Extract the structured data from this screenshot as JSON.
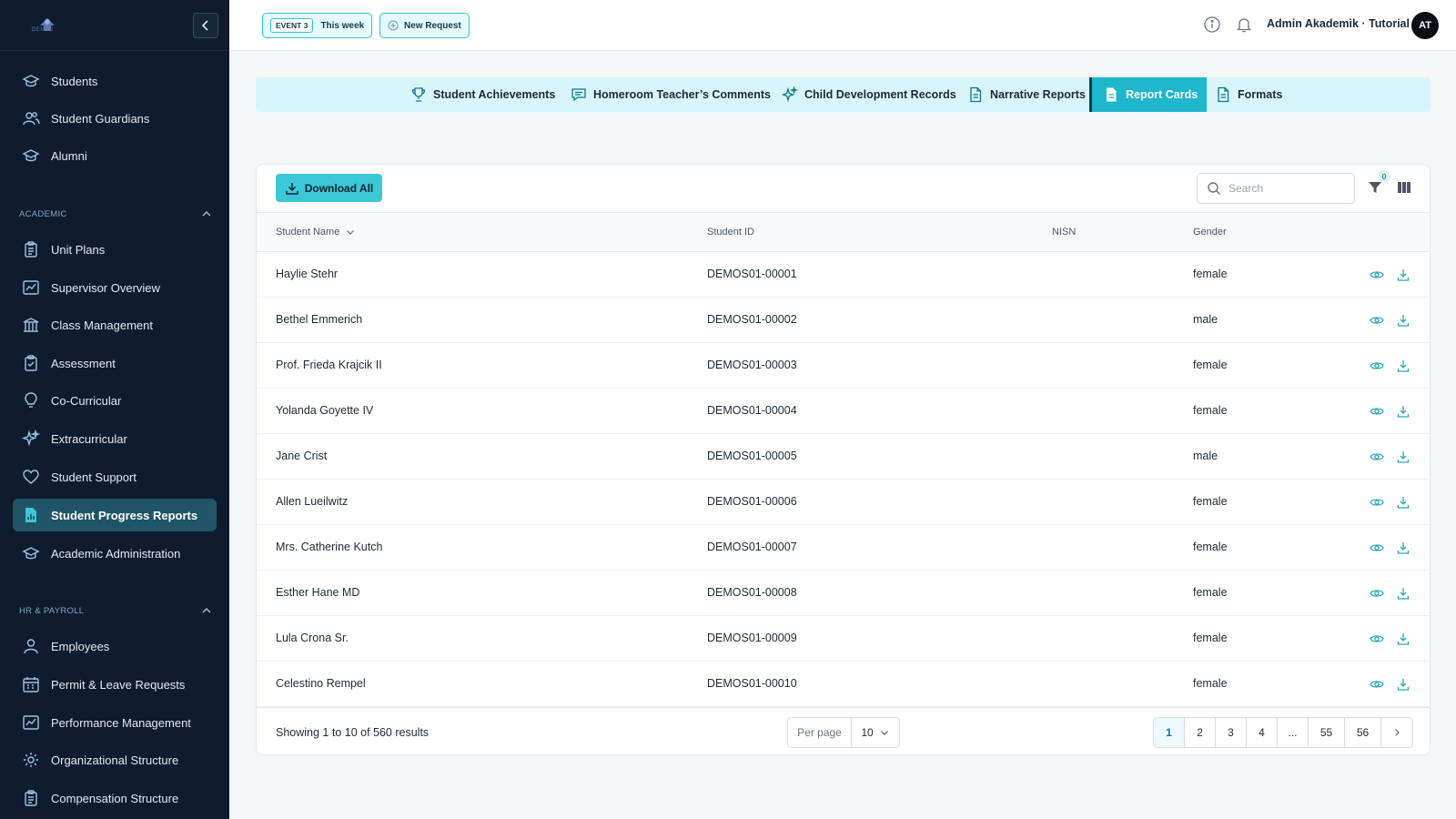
{
  "brand": {
    "logo_text": "DEMAS"
  },
  "sidebar": {
    "top_items": [
      {
        "label": "Students",
        "icon": "graduation-cap-icon"
      },
      {
        "label": "Student Guardians",
        "icon": "users-icon"
      },
      {
        "label": "Alumni",
        "icon": "graduation-cap-icon"
      }
    ],
    "sections": [
      {
        "title": "ACADEMIC",
        "items": [
          {
            "label": "Unit Plans",
            "icon": "clipboard-icon"
          },
          {
            "label": "Supervisor Overview",
            "icon": "chart-icon"
          },
          {
            "label": "Class Management",
            "icon": "building-icon"
          },
          {
            "label": "Assessment",
            "icon": "clipboard-check-icon"
          },
          {
            "label": "Co-Curricular",
            "icon": "lightbulb-icon"
          },
          {
            "label": "Extracurricular",
            "icon": "sparkles-icon"
          },
          {
            "label": "Student Support",
            "icon": "heart-icon"
          },
          {
            "label": "Student Progress Reports",
            "icon": "file-chart-icon",
            "active": true
          },
          {
            "label": "Academic Administration",
            "icon": "graduation-cap-icon"
          }
        ]
      },
      {
        "title": "HR & PAYROLL",
        "items": [
          {
            "label": "Employees",
            "icon": "user-icon"
          },
          {
            "label": "Permit & Leave Requests",
            "icon": "calendar-icon"
          },
          {
            "label": "Performance Management",
            "icon": "chart-icon"
          },
          {
            "label": "Organizational Structure",
            "icon": "gear-icon"
          },
          {
            "label": "Compensation Structure",
            "icon": "clipboard-icon"
          }
        ]
      }
    ]
  },
  "topbar": {
    "event_tag": "EVENT 3",
    "event_label": "This week",
    "new_request": "New Request",
    "user_name": "Admin Akademik · Tutorial",
    "avatar_initials": "AT"
  },
  "tabs": [
    {
      "label": "Student Achievements",
      "icon": "trophy-icon"
    },
    {
      "label": "Homeroom Teacher’s Comments",
      "icon": "chat-icon"
    },
    {
      "label": "Child Development Records",
      "icon": "sparkles-icon"
    },
    {
      "label": "Narrative Reports",
      "icon": "document-icon"
    },
    {
      "label": "Report Cards",
      "icon": "document-icon",
      "active": true
    },
    {
      "label": "Formats",
      "icon": "document-icon"
    }
  ],
  "toolbar": {
    "download_all": "Download All",
    "search_placeholder": "Search",
    "filter_count": "0"
  },
  "table": {
    "columns": [
      "Student Name",
      "Student ID",
      "NISN",
      "Gender"
    ],
    "rows": [
      {
        "name": "Haylie Stehr",
        "id": "DEMOS01-00001",
        "nisn": "",
        "gender": "female"
      },
      {
        "name": "Bethel Emmerich",
        "id": "DEMOS01-00002",
        "nisn": "",
        "gender": "male"
      },
      {
        "name": "Prof. Frieda Krajcik II",
        "id": "DEMOS01-00003",
        "nisn": "",
        "gender": "female"
      },
      {
        "name": "Yolanda Goyette IV",
        "id": "DEMOS01-00004",
        "nisn": "",
        "gender": "female"
      },
      {
        "name": "Jane Crist",
        "id": "DEMOS01-00005",
        "nisn": "",
        "gender": "male"
      },
      {
        "name": "Allen Lueilwitz",
        "id": "DEMOS01-00006",
        "nisn": "",
        "gender": "female"
      },
      {
        "name": "Mrs. Catherine Kutch",
        "id": "DEMOS01-00007",
        "nisn": "",
        "gender": "female"
      },
      {
        "name": "Esther Hane MD",
        "id": "DEMOS01-00008",
        "nisn": "",
        "gender": "female"
      },
      {
        "name": "Lula Crona Sr.",
        "id": "DEMOS01-00009",
        "nisn": "",
        "gender": "female"
      },
      {
        "name": "Celestino Rempel",
        "id": "DEMOS01-00010",
        "nisn": "",
        "gender": "female"
      }
    ]
  },
  "footer": {
    "showing": "Showing 1 to 10 of 560 results",
    "per_page_label": "Per page",
    "per_page_value": "10",
    "pages": [
      "1",
      "2",
      "3",
      "4",
      "...",
      "55",
      "56"
    ],
    "current_page": "1"
  },
  "colors": {
    "sidebar_bg": "#0f1c2e",
    "accent": "#1fb7cc",
    "tab_bar_bg": "#d8f6fa",
    "active_sidebar_bg": "#1f5566"
  }
}
